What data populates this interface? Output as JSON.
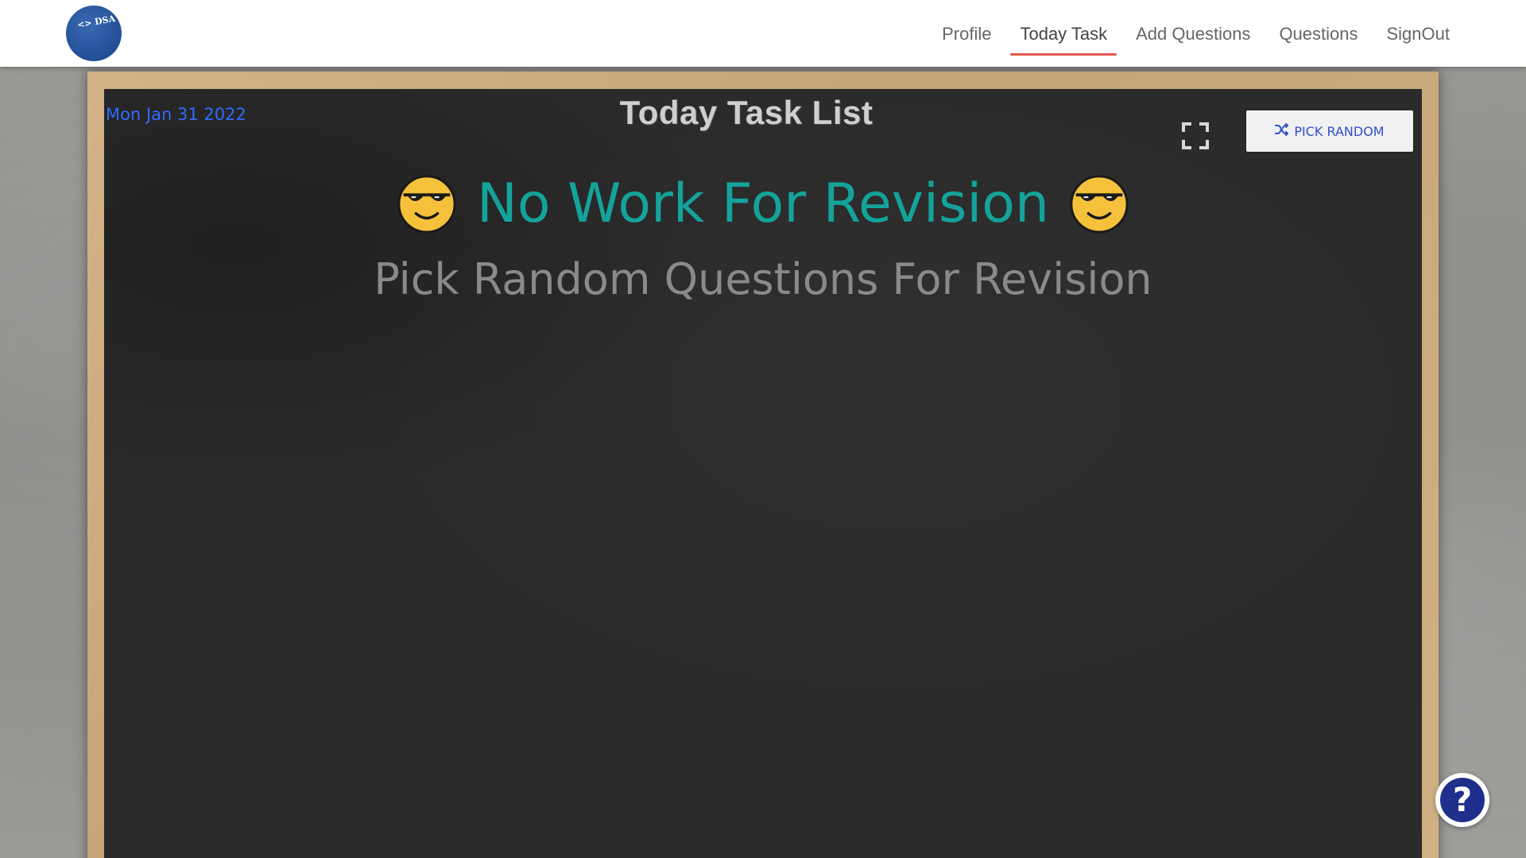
{
  "header": {
    "logo_text": "<> DSA",
    "nav": [
      {
        "label": "Profile",
        "active": false
      },
      {
        "label": "Today Task",
        "active": true
      },
      {
        "label": "Add Questions",
        "active": false
      },
      {
        "label": "Questions",
        "active": false
      },
      {
        "label": "SignOut",
        "active": false
      }
    ]
  },
  "board": {
    "date": "Mon Jan 31 2022",
    "title": "Today Task List",
    "pick_random_label": "PICK RANDOM",
    "headline": "No Work For Revision",
    "subline": "Pick Random Questions For Revision",
    "fullscreen_icon": "fullscreen-icon",
    "shuffle_icon": "shuffle-icon",
    "emoji_icon": "smiling-face-with-sunglasses"
  },
  "help": {
    "label": "?"
  },
  "colors": {
    "date": "#2f6bff",
    "headline": "#14a39a",
    "subline": "#8a8a8a",
    "nav_active_underline": "#e2574c",
    "help_bg": "#1f2f8c",
    "pick_button_text": "#2e4fc9"
  }
}
